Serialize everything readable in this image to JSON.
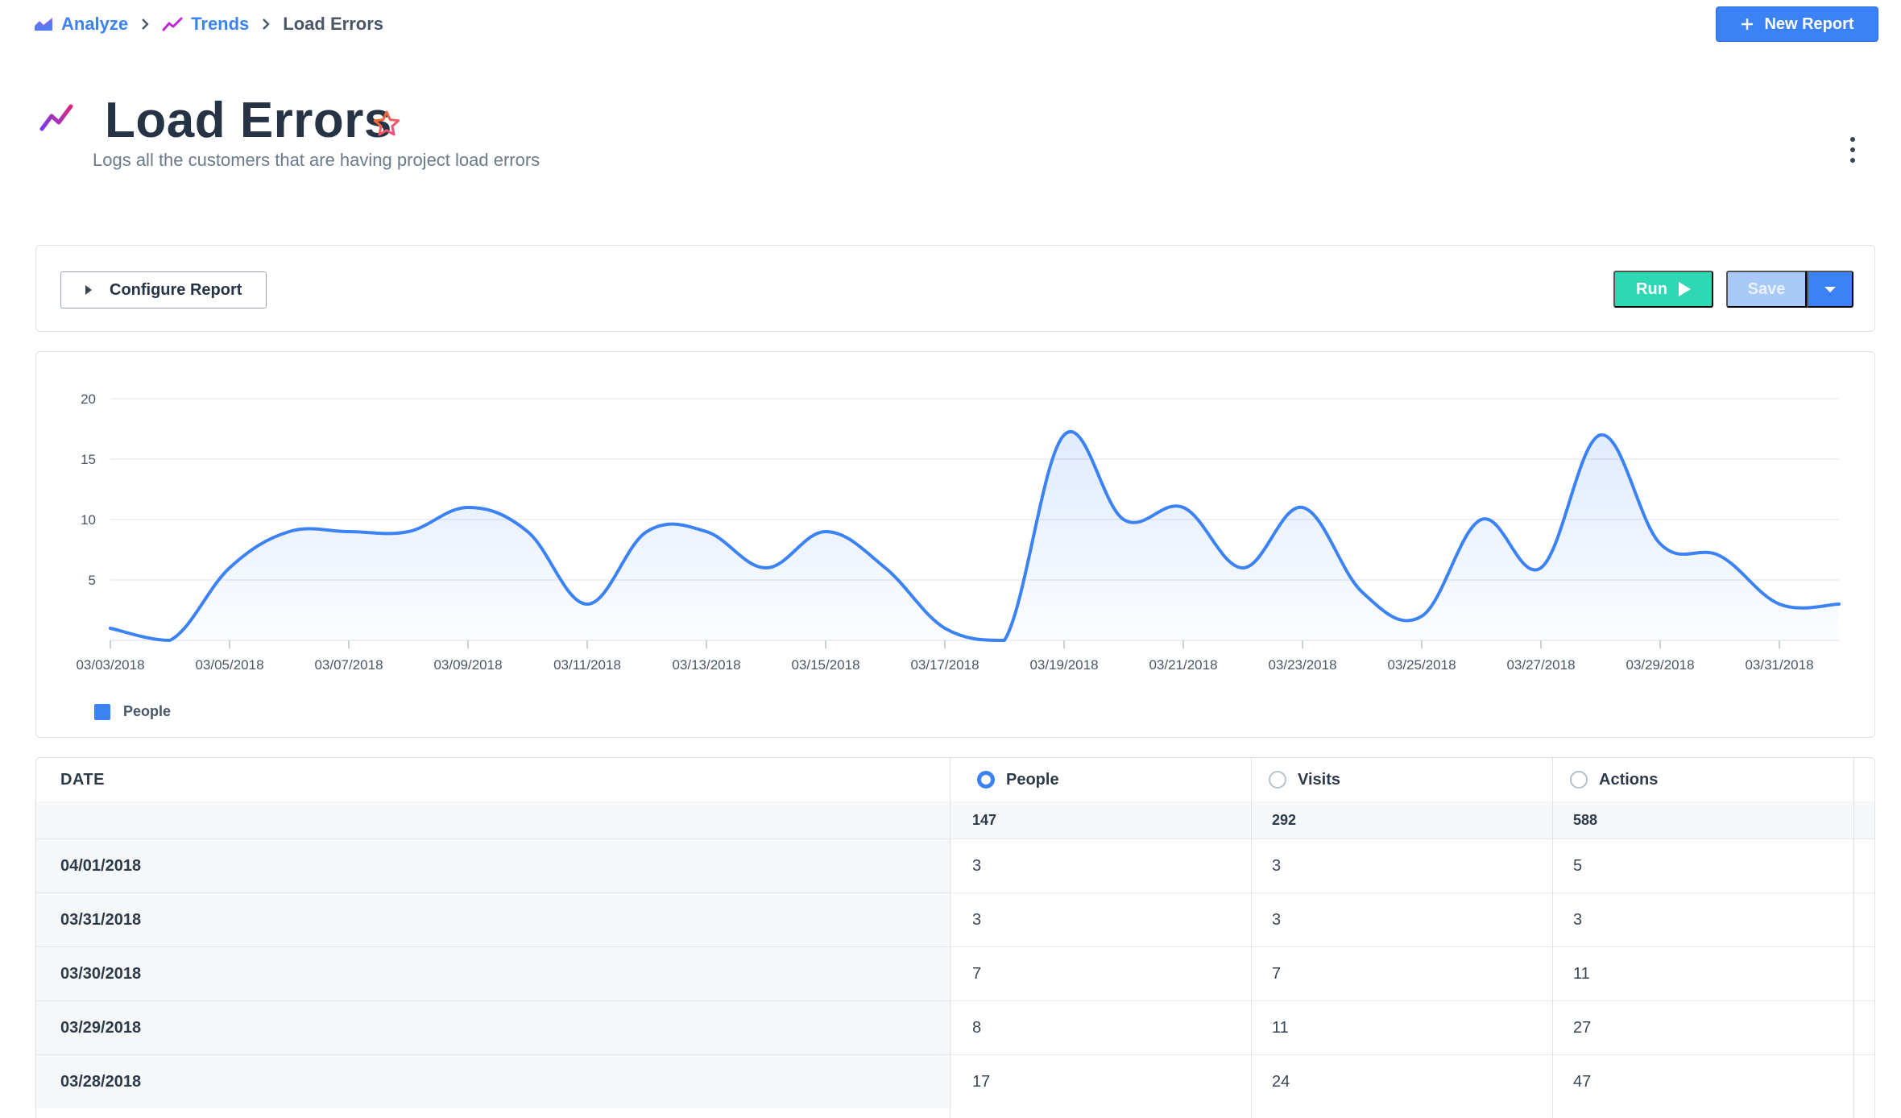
{
  "breadcrumb": {
    "items": [
      {
        "label": "Analyze",
        "icon": "area-chart-icon"
      },
      {
        "label": "Trends",
        "icon": "trend-line-icon"
      },
      {
        "label": "Load Errors"
      }
    ]
  },
  "header": {
    "new_report_label": "New Report",
    "title": "Load Errors",
    "description": "Logs all the customers that are having project load errors"
  },
  "toolbar": {
    "configure_label": "Configure Report",
    "run_label": "Run",
    "save_label": "Save"
  },
  "colors": {
    "accent": "#3b82f6",
    "run": "#2fd8b4",
    "save_disabled": "#a9c9f9",
    "trend_icon": "#c026d3",
    "star": "#f97316"
  },
  "chart_data": {
    "type": "area",
    "yticks": [
      5,
      10,
      15,
      20
    ],
    "ylim": [
      0,
      20
    ],
    "x_tick_labels": [
      "03/03/2018",
      "03/05/2018",
      "03/07/2018",
      "03/09/2018",
      "03/11/2018",
      "03/13/2018",
      "03/15/2018",
      "03/17/2018",
      "03/19/2018",
      "03/21/2018",
      "03/23/2018",
      "03/25/2018",
      "03/27/2018",
      "03/29/2018",
      "03/31/2018"
    ],
    "x": [
      "03/03/2018",
      "03/04/2018",
      "03/05/2018",
      "03/06/2018",
      "03/07/2018",
      "03/08/2018",
      "03/09/2018",
      "03/10/2018",
      "03/11/2018",
      "03/12/2018",
      "03/13/2018",
      "03/14/2018",
      "03/15/2018",
      "03/16/2018",
      "03/17/2018",
      "03/18/2018",
      "03/19/2018",
      "03/20/2018",
      "03/21/2018",
      "03/22/2018",
      "03/23/2018",
      "03/24/2018",
      "03/25/2018",
      "03/26/2018",
      "03/27/2018",
      "03/28/2018",
      "03/29/2018",
      "03/30/2018",
      "03/31/2018",
      "04/01/2018"
    ],
    "series": [
      {
        "name": "People",
        "values": [
          1,
          0,
          6,
          9,
          9,
          9,
          11,
          9,
          3,
          9,
          9,
          6,
          9,
          6,
          1,
          0,
          17,
          10,
          11,
          6,
          11,
          4,
          2,
          10,
          6,
          17,
          8,
          7,
          3,
          3
        ]
      }
    ],
    "legend": "bottom-left",
    "grid": true
  },
  "table": {
    "date_header": "DATE",
    "columns": [
      {
        "label": "People",
        "selected": true,
        "total": "147"
      },
      {
        "label": "Visits",
        "selected": false,
        "total": "292"
      },
      {
        "label": "Actions",
        "selected": false,
        "total": "588"
      }
    ],
    "rows": [
      {
        "date": "04/01/2018",
        "people": "3",
        "visits": "3",
        "actions": "5"
      },
      {
        "date": "03/31/2018",
        "people": "3",
        "visits": "3",
        "actions": "3"
      },
      {
        "date": "03/30/2018",
        "people": "7",
        "visits": "7",
        "actions": "11"
      },
      {
        "date": "03/29/2018",
        "people": "8",
        "visits": "11",
        "actions": "27"
      },
      {
        "date": "03/28/2018",
        "people": "17",
        "visits": "24",
        "actions": "47"
      }
    ]
  }
}
